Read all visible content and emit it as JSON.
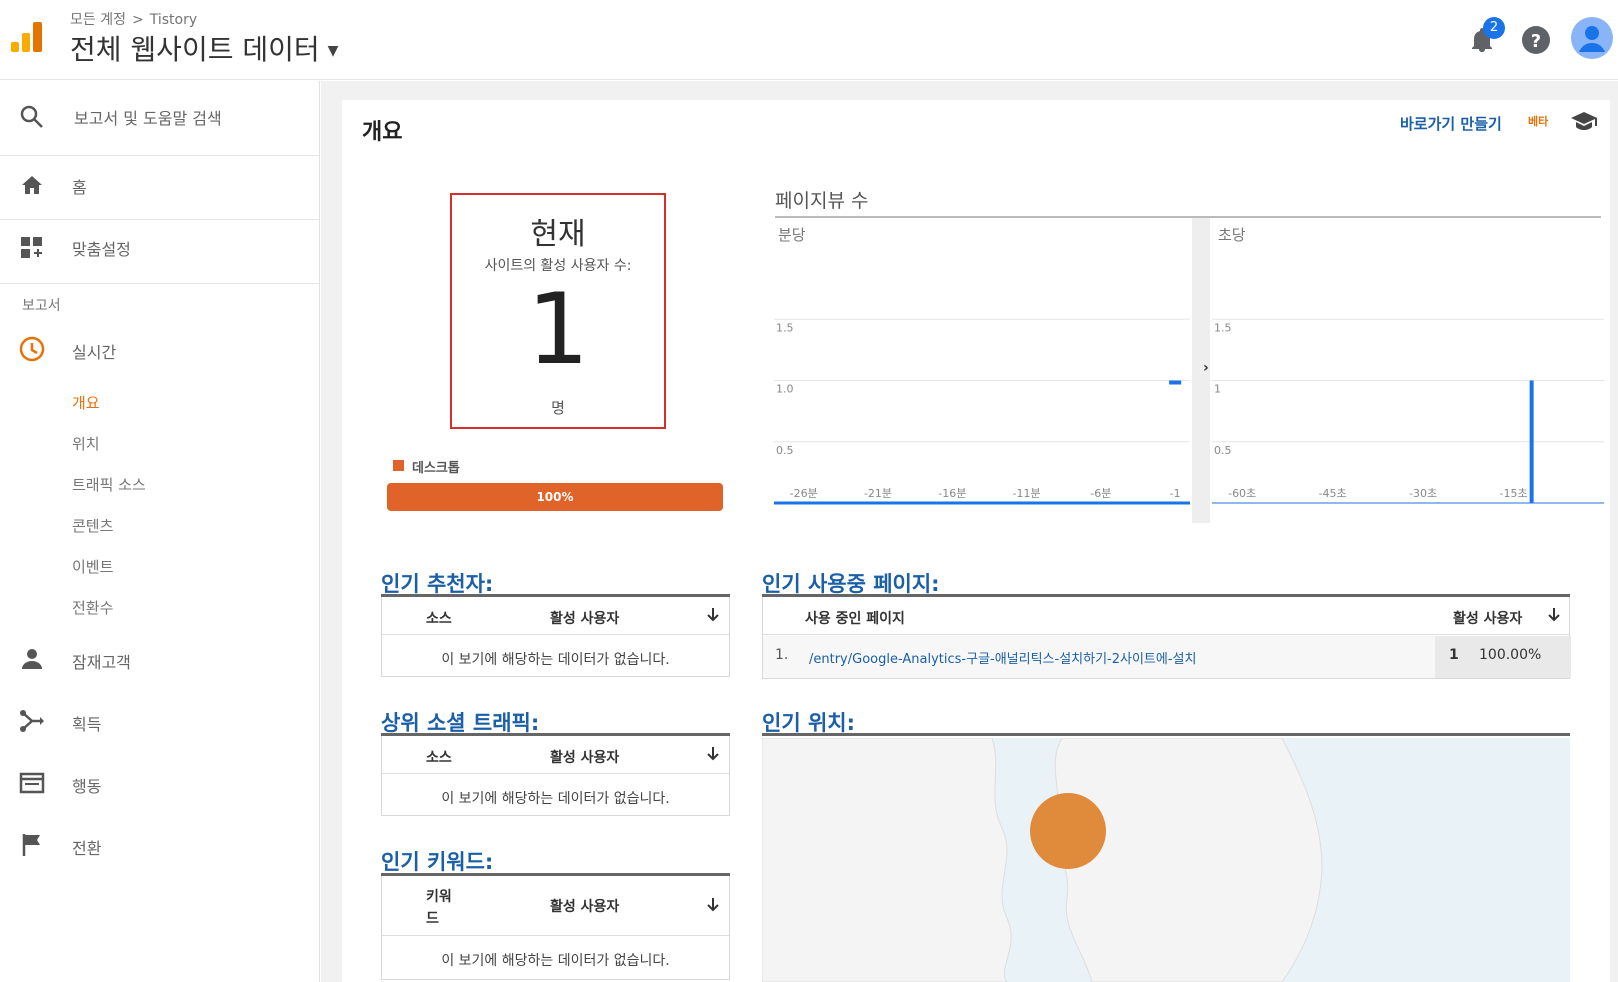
{
  "header": {
    "breadcrumb": [
      "모든 계정",
      "Tistory"
    ],
    "breadcrumb_sep": ">",
    "property_title": "전체 웹사이트 데이터",
    "notification_count": "2",
    "brand_color": "#f9ab00"
  },
  "sidebar": {
    "search_label": "보고서 및 도움말 검색",
    "home_label": "홈",
    "customize_label": "맞춤설정",
    "reports_section": "보고서",
    "realtime_label": "실시간",
    "realtime_sub": [
      "개요",
      "위치",
      "트래픽 소스",
      "콘텐츠",
      "이벤트",
      "전환수"
    ],
    "audience_label": "잠재고객",
    "acquisition_label": "획득",
    "behavior_label": "행동",
    "conversion_label": "전환"
  },
  "main": {
    "title": "개요",
    "shortcut_label": "바로가기 만들기",
    "beta_label": "베타",
    "now": {
      "title": "현재",
      "subtitle": "사이트의 활성 사용자 수:",
      "value": "1",
      "unit": "명"
    },
    "device": {
      "label": "데스크톱",
      "percent_label": "100%",
      "share": 1.0,
      "color": "#e0632a"
    },
    "pageviews": {
      "title": "페이지뷰 수",
      "per_minute_label": "분당",
      "per_second_label": "초당"
    },
    "top_referrals": {
      "title": "인기 추천자:",
      "col_source": "소스",
      "col_active": "활성 사용자",
      "empty": "이 보기에 해당하는 데이터가 없습니다."
    },
    "top_social": {
      "title": "상위 소셜 트래픽:",
      "col_source": "소스",
      "col_active": "활성 사용자",
      "empty": "이 보기에 해당하는 데이터가 없습니다."
    },
    "top_keywords": {
      "title": "인기 키워드:",
      "col_keyword_1": "키워",
      "col_keyword_2": "드",
      "col_active": "활성 사용자",
      "empty": "이 보기에 해당하는 데이터가 없습니다."
    },
    "top_pages": {
      "title": "인기 사용중 페이지:",
      "col_page": "사용 중인 페이지",
      "col_active": "활성 사용자",
      "rows": [
        {
          "index": "1.",
          "path": "/entry/Google-Analytics-구글-애널리틱스-설치하기-2사이트에-설치",
          "count": "1",
          "percent": "100.00%"
        }
      ]
    },
    "top_locations": {
      "title": "인기 위치:",
      "bubble_color": "#e08a3c"
    }
  },
  "chart_data": [
    {
      "type": "bar",
      "name_label": "분당",
      "x_ticks": [
        "-26분",
        "-21분",
        "-16분",
        "-11분",
        "-6분",
        "-1"
      ],
      "y_ticks": [
        "0.5",
        "1.0",
        "1.5"
      ],
      "ylim": [
        0,
        2
      ],
      "x": [
        -1
      ],
      "values": [
        1
      ],
      "color": "#1a73e8"
    },
    {
      "type": "bar",
      "name_label": "초당",
      "x_ticks": [
        "-60초",
        "-45초",
        "-30초",
        "-15초"
      ],
      "y_ticks": [
        "0.5",
        "1",
        "1.5"
      ],
      "ylim": [
        0,
        2
      ],
      "x": [
        -12
      ],
      "values": [
        1
      ],
      "color": "#1a73e8"
    }
  ]
}
